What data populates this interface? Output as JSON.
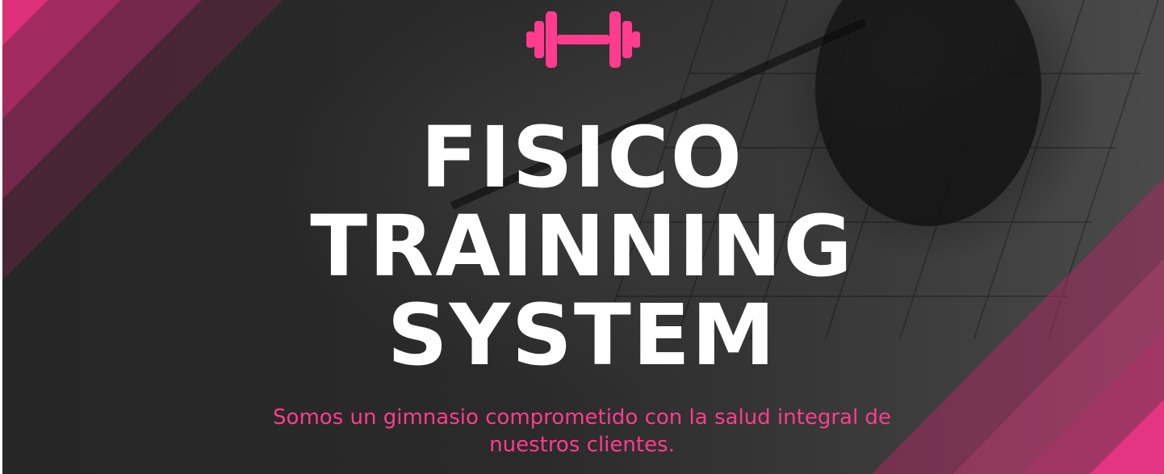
{
  "brand": {
    "icon": "dumbbell-icon",
    "accent_color": "#ff3c8d"
  },
  "hero": {
    "title_lines": [
      "FISICO",
      "TRAINNING",
      "SYSTEM"
    ],
    "subtitle": "Somos un gimnasio comprometido con la salud integral de nuestros clientes."
  }
}
